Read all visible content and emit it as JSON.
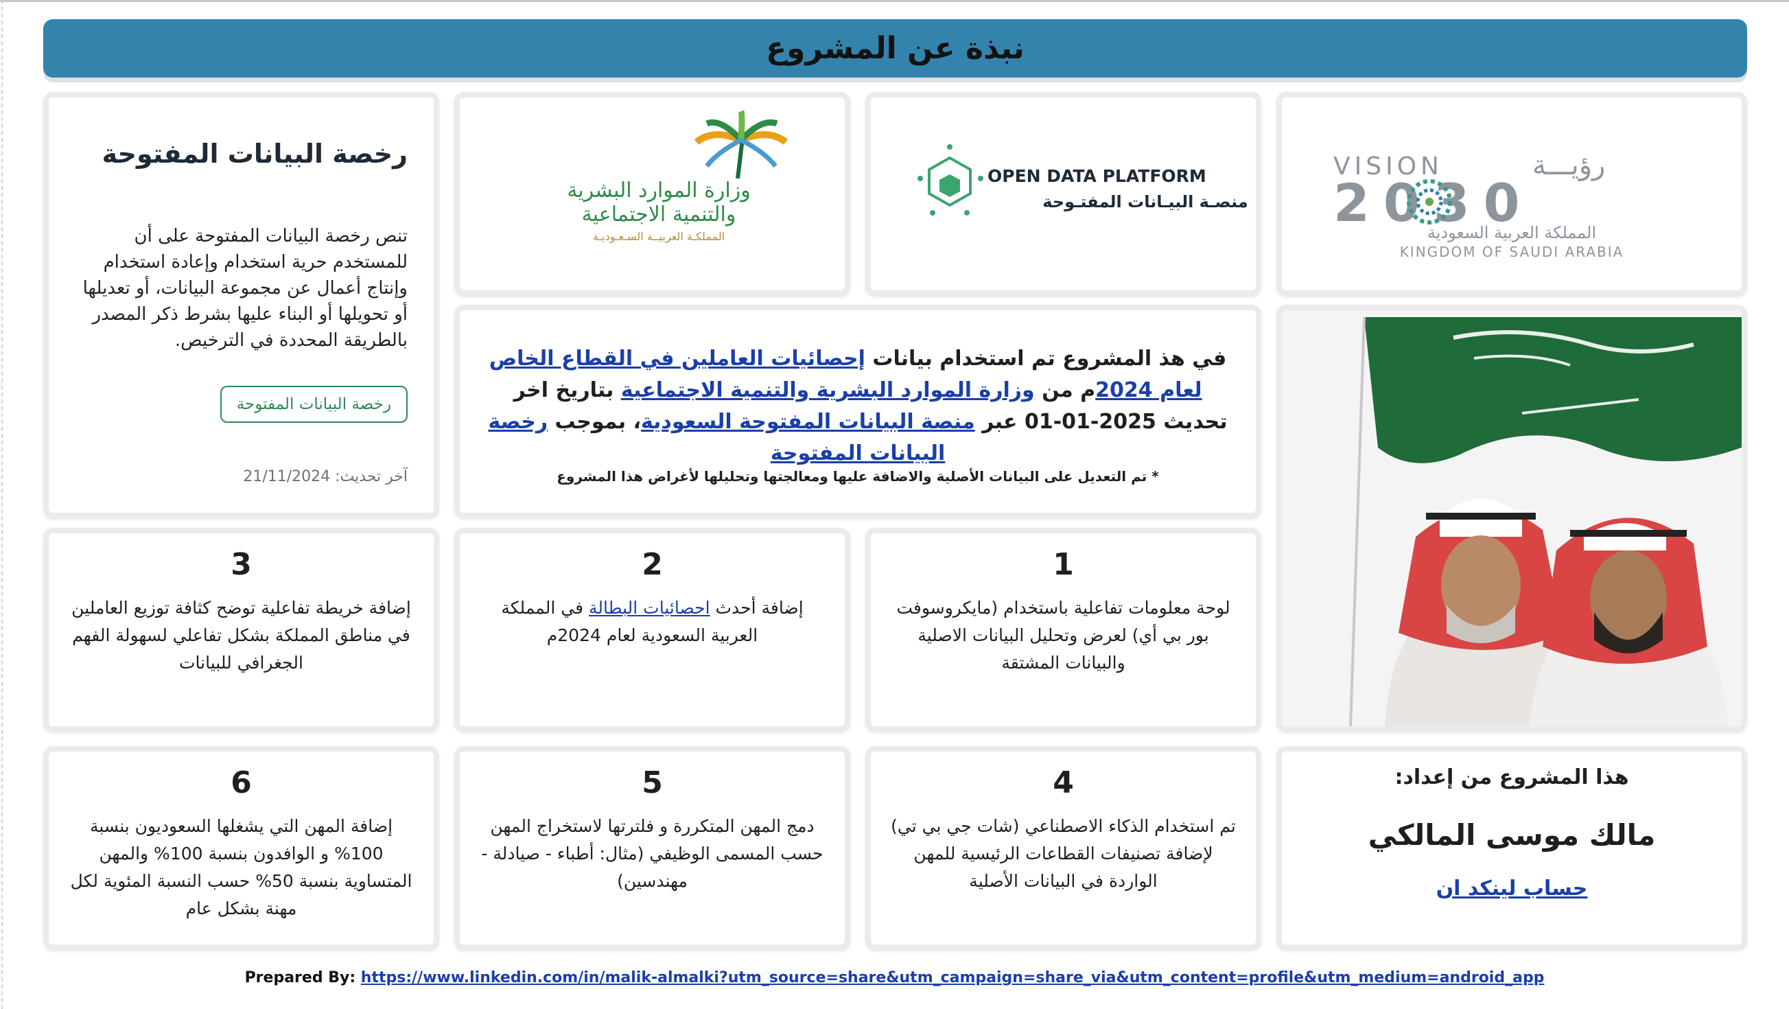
{
  "header": {
    "title": "نبذة عن المشروع"
  },
  "logos": {
    "vision": {
      "arabic_top": "رؤيـــة",
      "latin": "VISION",
      "year": "2030",
      "arabic_kingdom": "المملكة العربية السعودية",
      "latin_kingdom": "KINGDOM OF SAUDI ARABIA"
    },
    "open_data": {
      "en": "OPEN DATA PLATFORM",
      "ar": "منصـة البيـانات المفتـوحة"
    },
    "ministry": {
      "line1": "وزارة الموارد البشرية",
      "line2": "والتنمية الاجتماعية",
      "line3": "المملكـة العربيــة السـعـوديـة"
    }
  },
  "license": {
    "title": "رخصة البيانات المفتوحة",
    "body": "تنص رخصة البيانات المفتوحة على أن للمستخدم حرية استخدام وإعادة استخدام وإنتاج أعمال عن مجموعة البيانات، أو تعديلها أو تحويلها أو البناء عليها بشرط ذكر المصدر بالطريقة المحددة في الترخيص.",
    "button": "رخصة البيانات المفتوحة",
    "updated_label": "آخر تحديث:",
    "updated_date": "21/11/2024"
  },
  "about": {
    "t1": "في هذ المشروع تم استخدام بيانات ",
    "link1": "إحصائيات  العاملين في القطاع الخاص لعام 2024",
    "t2": "م من ",
    "link2": "وزارة الموارد البشرية والتنمية الاجتماعية",
    "t3": " بتاريخ اخر تحديث 2025-01-01 عبر ",
    "link3": "منصة البيانات المفتوحة السعودية",
    "t4": "، بموجب ",
    "link4": "رخصة البيانات المفتوحة",
    "note": "* تم التعديل على البيانات الأصلية والاضافة عليها ومعالجتها وتحليلها  لأغراض هذا المشروع"
  },
  "photo": {
    "alt": "ولي العهد والملك مع العلم السعودي"
  },
  "features": [
    {
      "num": "1",
      "text": "لوحة معلومات تفاعلية باستخدام (مايكروسوفت بور بي أي) لعرض وتحليل البيانات الاصلية والبيانات المشتقة"
    },
    {
      "num": "2",
      "pre": "إضافة أحدث ",
      "link": "احصائيات البطالة",
      "post": " في المملكة العربية السعودية لعام 2024م"
    },
    {
      "num": "3",
      "text": "إضافة خريطة تفاعلية توضح كثافة توزيع العاملين في مناطق المملكة بشكل تفاعلي لسهولة الفهم الجغرافي للبيانات"
    },
    {
      "num": "4",
      "text": "تم استخدام الذكاء الاصطناعي (شات جي بي تي) لإضافة تصنيفات القطاعات الرئيسية للمهن الواردة في البيانات الأصلية"
    },
    {
      "num": "5",
      "text": "دمج المهن المتكررة و فلترتها لاستخراج المهن حسب المسمى الوظيفي (مثال: أطباء - صيادلة - مهندسين)"
    },
    {
      "num": "6",
      "text": "إضافة المهن التي يشغلها السعوديون بنسبة 100% و الوافدون بنسبة 100% والمهن المتساوية بنسبة 50% حسب النسبة المئوية لكل مهنة بشكل عام"
    }
  ],
  "author": {
    "label": "هذا المشروع من إعداد:",
    "name": "مالك موسى المالكي",
    "link": "حساب لينكد ان"
  },
  "footer": {
    "prefix": "Prepared By: ",
    "url": "https://www.linkedin.com/in/malik-almalki?utm_source=share&utm_campaign=share_via&utm_content=profile&utm_medium=android_app"
  },
  "colors": {
    "header_bg": "#3383ad",
    "link": "#1a3fa8",
    "button_border": "#2f8a57"
  }
}
